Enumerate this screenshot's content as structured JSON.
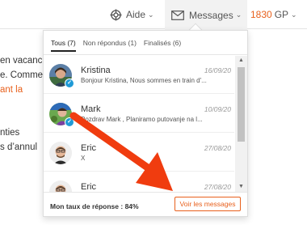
{
  "topbar": {
    "help_label": "Aide",
    "messages_label": "Messages",
    "credits_value": "1830",
    "credits_unit": "GP",
    "chevron": "⌄"
  },
  "background": {
    "lines": [
      "en vacanc",
      "e. Comme",
      "ant la",
      "nties",
      "s d’annul"
    ]
  },
  "messages_panel": {
    "tabs": [
      {
        "label": "Tous",
        "count": "(7)",
        "active": true
      },
      {
        "label": "Non répondus",
        "count": "(1)",
        "active": false
      },
      {
        "label": "Finalisés",
        "count": "(6)",
        "active": false
      }
    ],
    "items": [
      {
        "name": "Kristina",
        "date": "16/09/20",
        "preview": "Bonjour Kristina, Nous sommes en train d'...",
        "verified": true,
        "avatar_icon": "user-photo"
      },
      {
        "name": "Mark",
        "date": "10/09/20",
        "preview": "Pozdrav Mark , Planiramo putovanje na l...",
        "verified": true,
        "avatar_icon": "user-photo"
      },
      {
        "name": "Eric",
        "date": "27/08/20",
        "preview": "X",
        "verified": false,
        "avatar_icon": "user-photo"
      },
      {
        "name": "Eric",
        "date": "27/08/20",
        "preview": "",
        "verified": false,
        "avatar_icon": "user-photo"
      }
    ],
    "response_rate": "Mon taux de réponse : 84%",
    "view_messages_label": "Voir les messages"
  },
  "colors": {
    "accent": "#e8601c",
    "verified_badge": "#1f9ad6",
    "annotation_arrow": "#f03c0f"
  }
}
